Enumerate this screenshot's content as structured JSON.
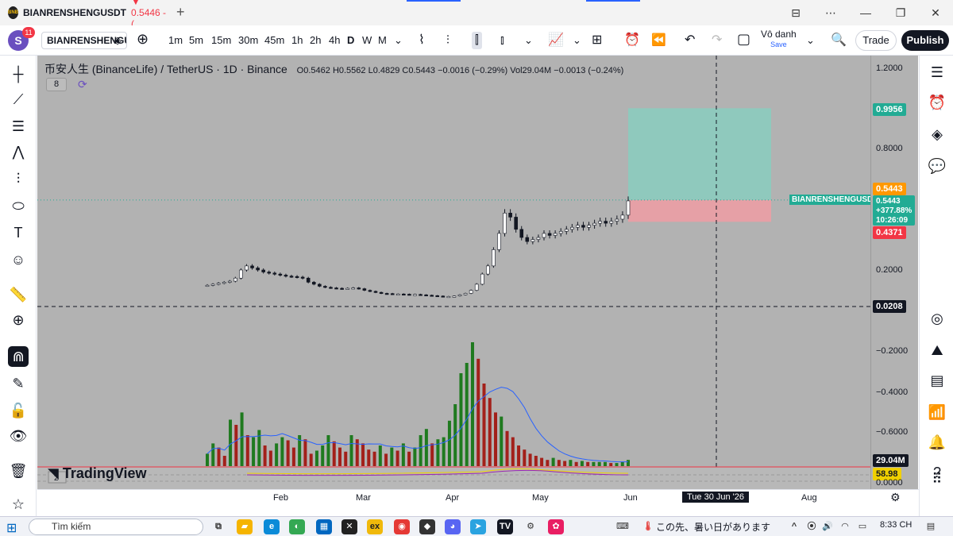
{
  "browser": {
    "tab_title": "BIANRENSHENGUSDT",
    "tab_price": "▼ 0.5446 -(",
    "new_tab": "+"
  },
  "toolbar": {
    "avatar_letter": "S",
    "notification_count": "11",
    "symbol": "BIANRENSHENGUSDT",
    "timeframes": [
      "1m",
      "5m",
      "15m",
      "30m",
      "45m",
      "1h",
      "2h",
      "4h",
      "D",
      "W",
      "M"
    ],
    "active_timeframe": "D",
    "layout_name": "Vô danh",
    "layout_status": "Save",
    "trade_label": "Trade",
    "publish_label": "Publish"
  },
  "legend": {
    "title": "币安人生 (BinanceLife) / TetherUS · 1D · Binance",
    "open": "O0.5462",
    "high": "H0.5562",
    "low": "L0.4829",
    "close": "C0.5443",
    "change": "−0.0016 (−0.29%)",
    "volume": "Vol29.04M",
    "vol_change": "−0.0013 (−0.24%)",
    "indicator_count": "8"
  },
  "price_axis": {
    "labels": [
      "1.2000",
      "0.8000",
      "0.2000",
      "−0.2000",
      "−0.4000",
      "−0.6000",
      "0.0000"
    ],
    "tag_target": "0.9956",
    "tag_entry": "0.5443",
    "tag_current": "0.5443",
    "tag_change": "+377.88%",
    "tag_countdown": "10:26:09",
    "tag_stop": "0.4371",
    "tag_crosshair": "0.0208",
    "tag_volume": "29.04M",
    "tag_indicator": "58.98"
  },
  "symbol_tag": "BIANRENSHENGUSDT",
  "time_axis": {
    "labels": [
      "Feb",
      "Mar",
      "Apr",
      "May",
      "Jun",
      "Aug"
    ],
    "crosshair_date": "Tue 30 Jun '26"
  },
  "pane2_count": "2",
  "watermark": "TradingView",
  "chart_data": {
    "type": "candlestick",
    "series_price": [
      0.125,
      0.13,
      0.135,
      0.14,
      0.145,
      0.16,
      0.2,
      0.22,
      0.21,
      0.2,
      0.19,
      0.185,
      0.18,
      0.175,
      0.17,
      0.168,
      0.165,
      0.16,
      0.14,
      0.13,
      0.12,
      0.115,
      0.112,
      0.11,
      0.108,
      0.11,
      0.112,
      0.108,
      0.1,
      0.095,
      0.09,
      0.085,
      0.084,
      0.082,
      0.082,
      0.081,
      0.08,
      0.08,
      0.078,
      0.076,
      0.074,
      0.072,
      0.07,
      0.07,
      0.072,
      0.078,
      0.085,
      0.1,
      0.13,
      0.18,
      0.22,
      0.3,
      0.38,
      0.48,
      0.46,
      0.4,
      0.36,
      0.34,
      0.35,
      0.36,
      0.38,
      0.37,
      0.38,
      0.39,
      0.4,
      0.41,
      0.42,
      0.41,
      0.42,
      0.43,
      0.44,
      0.43,
      0.44,
      0.45,
      0.47,
      0.54
    ],
    "series_volume": [
      12,
      22,
      18,
      10,
      45,
      40,
      52,
      30,
      28,
      35,
      20,
      15,
      22,
      28,
      25,
      18,
      30,
      26,
      12,
      15,
      20,
      30,
      24,
      18,
      14,
      30,
      26,
      22,
      16,
      14,
      20,
      12,
      18,
      15,
      22,
      14,
      18,
      30,
      36,
      22,
      26,
      28,
      44,
      60,
      90,
      100,
      120,
      104,
      80,
      66,
      52,
      48,
      34,
      28,
      20,
      16,
      12,
      10,
      8,
      6,
      8,
      6,
      5,
      6,
      4,
      5,
      4,
      4,
      4,
      4,
      3,
      3,
      4,
      6
    ],
    "xlabel": "",
    "ylabel": ""
  },
  "taskbar": {
    "search_placeholder": "Tìm kiếm",
    "tray_text": "この先、暑い日があります",
    "clock": "8:33 CH"
  }
}
